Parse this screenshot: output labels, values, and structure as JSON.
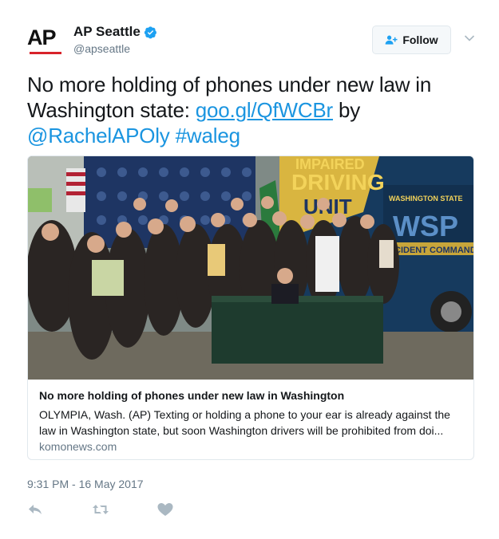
{
  "account": {
    "avatar_text": "AP",
    "display_name": "AP Seattle",
    "handle": "@apseattle",
    "verified": true
  },
  "follow_button": {
    "label": "Follow",
    "icon": "add-user-icon"
  },
  "tweet": {
    "text_before": "No more holding of phones under new law in Washington state: ",
    "link": "goo.gl/QfWCBr",
    "text_by": " by ",
    "mention": "@RachelAPOly",
    "hashtag": "#waleg"
  },
  "card": {
    "image_text": {
      "banner_line1": "IMPAIRED",
      "banner_line2": "DRIVING",
      "banner_line3": "UNIT",
      "wsp_top": "WASHINGTON STATE",
      "wsp_logo": "WSP",
      "command": "INCIDENT COMMAND"
    },
    "title": "No more holding of phones under new law in Washington",
    "description": "OLYMPIA, Wash. (AP) Texting or holding a phone to your ear is already against the law in Washington state, but soon Washington drivers will be prohibited from doi...",
    "domain": "komonews.com"
  },
  "timestamp": "9:31 PM - 16 May 2017",
  "actions": [
    "reply-icon",
    "retweet-icon",
    "like-icon"
  ],
  "colors": {
    "link": "#1b95e0",
    "verified": "#1da1f2",
    "muted": "#657786",
    "ap_red": "#d8232a"
  }
}
